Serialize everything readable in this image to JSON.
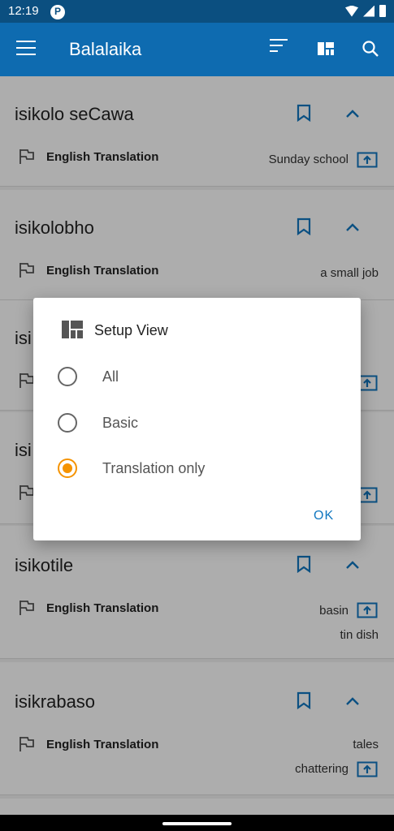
{
  "status_bar": {
    "time": "12:19"
  },
  "app_bar": {
    "title": "Balalaika"
  },
  "entries": [
    {
      "word": "isikolo seCawa",
      "label": "English Translation",
      "translation": "Sunday school",
      "translation2": ""
    },
    {
      "word": "isikolobho",
      "label": "English Translation",
      "translation": "a small job",
      "translation2": ""
    },
    {
      "word": "isi",
      "label": "",
      "translation": "",
      "translation2": ""
    },
    {
      "word": "isi",
      "label": "",
      "translation": "",
      "translation2": ""
    },
    {
      "word": "isikotile",
      "label": "English Translation",
      "translation": "basin",
      "translation2": "tin dish"
    },
    {
      "word": "isikrabaso",
      "label": "English Translation",
      "translation": "tales",
      "translation2": "chattering"
    }
  ],
  "dialog": {
    "title": "Setup View",
    "options": [
      {
        "label": "All",
        "selected": false
      },
      {
        "label": "Basic",
        "selected": false
      },
      {
        "label": "Translation only",
        "selected": true
      }
    ],
    "ok_label": "OK"
  },
  "colors": {
    "primary": "#0e6bb0",
    "accent": "#f59300",
    "link": "#1177c0"
  }
}
